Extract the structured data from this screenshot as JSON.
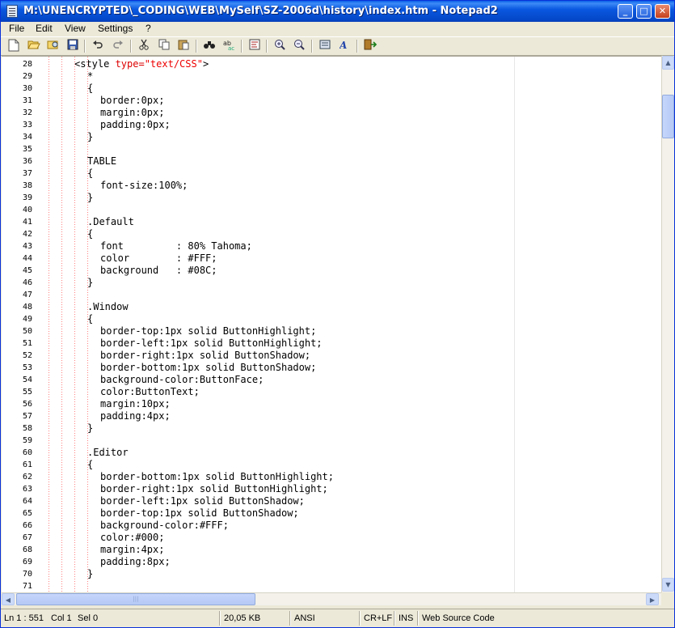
{
  "window": {
    "title": "M:\\UNENCRYPTED\\_CODING\\WEB\\MySelf\\SZ-2006d\\history\\index.htm - Notepad2",
    "buttons": {
      "minimize": "_",
      "maximize": "□",
      "close": "✕"
    }
  },
  "menu": [
    "File",
    "Edit",
    "View",
    "Settings",
    "?"
  ],
  "toolbar": [
    "new-file",
    "open-file",
    "browse",
    "save",
    "undo",
    "redo",
    "cut",
    "copy",
    "paste",
    "find",
    "replace",
    "word-wrap",
    "zoom-in",
    "zoom-out",
    "scheme",
    "font",
    "exit"
  ],
  "editor": {
    "lines": [
      {
        "num": "28",
        "indent": 2,
        "parts": [
          {
            "t": "<style ",
            "c": "tag"
          },
          {
            "t": "type=",
            "c": "attr"
          },
          {
            "t": "\"text/CSS\"",
            "c": "val"
          },
          {
            "t": ">",
            "c": "tag"
          }
        ]
      },
      {
        "num": "29",
        "indent": 3,
        "parts": [
          {
            "t": "*",
            "c": ""
          }
        ]
      },
      {
        "num": "30",
        "indent": 3,
        "parts": [
          {
            "t": "{",
            "c": ""
          }
        ]
      },
      {
        "num": "31",
        "indent": 4,
        "parts": [
          {
            "t": "border:0px;",
            "c": ""
          }
        ]
      },
      {
        "num": "32",
        "indent": 4,
        "parts": [
          {
            "t": "margin:0px;",
            "c": ""
          }
        ]
      },
      {
        "num": "33",
        "indent": 4,
        "parts": [
          {
            "t": "padding:0px;",
            "c": ""
          }
        ]
      },
      {
        "num": "34",
        "indent": 3,
        "parts": [
          {
            "t": "}",
            "c": ""
          }
        ]
      },
      {
        "num": "35",
        "indent": 3,
        "parts": []
      },
      {
        "num": "36",
        "indent": 3,
        "parts": [
          {
            "t": "TABLE",
            "c": ""
          }
        ]
      },
      {
        "num": "37",
        "indent": 3,
        "parts": [
          {
            "t": "{",
            "c": ""
          }
        ]
      },
      {
        "num": "38",
        "indent": 4,
        "parts": [
          {
            "t": "font-size:100%;",
            "c": ""
          }
        ]
      },
      {
        "num": "39",
        "indent": 3,
        "parts": [
          {
            "t": "}",
            "c": ""
          }
        ]
      },
      {
        "num": "40",
        "indent": 3,
        "parts": []
      },
      {
        "num": "41",
        "indent": 3,
        "parts": [
          {
            "t": ".Default",
            "c": ""
          }
        ]
      },
      {
        "num": "42",
        "indent": 3,
        "parts": [
          {
            "t": "{",
            "c": ""
          }
        ]
      },
      {
        "num": "43",
        "indent": 4,
        "parts": [
          {
            "t": "font         : 80% Tahoma;",
            "c": ""
          }
        ]
      },
      {
        "num": "44",
        "indent": 4,
        "parts": [
          {
            "t": "color        : #FFF;",
            "c": ""
          }
        ]
      },
      {
        "num": "45",
        "indent": 4,
        "parts": [
          {
            "t": "background   : #08C;",
            "c": ""
          }
        ]
      },
      {
        "num": "46",
        "indent": 3,
        "parts": [
          {
            "t": "}",
            "c": ""
          }
        ]
      },
      {
        "num": "47",
        "indent": 3,
        "parts": []
      },
      {
        "num": "48",
        "indent": 3,
        "parts": [
          {
            "t": ".Window",
            "c": ""
          }
        ]
      },
      {
        "num": "49",
        "indent": 3,
        "parts": [
          {
            "t": "{",
            "c": ""
          }
        ]
      },
      {
        "num": "50",
        "indent": 4,
        "parts": [
          {
            "t": "border-top:1px solid ButtonHighlight;",
            "c": ""
          }
        ]
      },
      {
        "num": "51",
        "indent": 4,
        "parts": [
          {
            "t": "border-left:1px solid ButtonHighlight;",
            "c": ""
          }
        ]
      },
      {
        "num": "52",
        "indent": 4,
        "parts": [
          {
            "t": "border-right:1px solid ButtonShadow;",
            "c": ""
          }
        ]
      },
      {
        "num": "53",
        "indent": 4,
        "parts": [
          {
            "t": "border-bottom:1px solid ButtonShadow;",
            "c": ""
          }
        ]
      },
      {
        "num": "54",
        "indent": 4,
        "parts": [
          {
            "t": "background-color:ButtonFace;",
            "c": ""
          }
        ]
      },
      {
        "num": "55",
        "indent": 4,
        "parts": [
          {
            "t": "color:ButtonText;",
            "c": ""
          }
        ]
      },
      {
        "num": "56",
        "indent": 4,
        "parts": [
          {
            "t": "margin:10px;",
            "c": ""
          }
        ]
      },
      {
        "num": "57",
        "indent": 4,
        "parts": [
          {
            "t": "padding:4px;",
            "c": ""
          }
        ]
      },
      {
        "num": "58",
        "indent": 3,
        "parts": [
          {
            "t": "}",
            "c": ""
          }
        ]
      },
      {
        "num": "59",
        "indent": 3,
        "parts": []
      },
      {
        "num": "60",
        "indent": 3,
        "parts": [
          {
            "t": ".Editor",
            "c": ""
          }
        ]
      },
      {
        "num": "61",
        "indent": 3,
        "parts": [
          {
            "t": "{",
            "c": ""
          }
        ]
      },
      {
        "num": "62",
        "indent": 4,
        "parts": [
          {
            "t": "border-bottom:1px solid ButtonHighlight;",
            "c": ""
          }
        ]
      },
      {
        "num": "63",
        "indent": 4,
        "parts": [
          {
            "t": "border-right:1px solid ButtonHighlight;",
            "c": ""
          }
        ]
      },
      {
        "num": "64",
        "indent": 4,
        "parts": [
          {
            "t": "border-left:1px solid ButtonShadow;",
            "c": ""
          }
        ]
      },
      {
        "num": "65",
        "indent": 4,
        "parts": [
          {
            "t": "border-top:1px solid ButtonShadow;",
            "c": ""
          }
        ]
      },
      {
        "num": "66",
        "indent": 4,
        "parts": [
          {
            "t": "background-color:#FFF;",
            "c": ""
          }
        ]
      },
      {
        "num": "67",
        "indent": 4,
        "parts": [
          {
            "t": "color:#000;",
            "c": ""
          }
        ]
      },
      {
        "num": "68",
        "indent": 4,
        "parts": [
          {
            "t": "margin:4px;",
            "c": ""
          }
        ]
      },
      {
        "num": "69",
        "indent": 4,
        "parts": [
          {
            "t": "padding:8px;",
            "c": ""
          }
        ]
      },
      {
        "num": "70",
        "indent": 3,
        "parts": [
          {
            "t": "}",
            "c": ""
          }
        ]
      },
      {
        "num": "71",
        "indent": 3,
        "parts": []
      }
    ]
  },
  "status": {
    "position": "Ln 1 : 551",
    "column": "Col 1",
    "selection": "Sel 0",
    "size": "20,05 KB",
    "encoding": "ANSI",
    "line_endings": "CR+LF",
    "insert_mode": "INS",
    "scheme": "Web Source Code"
  },
  "colors": {
    "titlebar": "#0a58e0",
    "tag_attr": "#dd0000",
    "indent_guide": "#ff8080"
  }
}
